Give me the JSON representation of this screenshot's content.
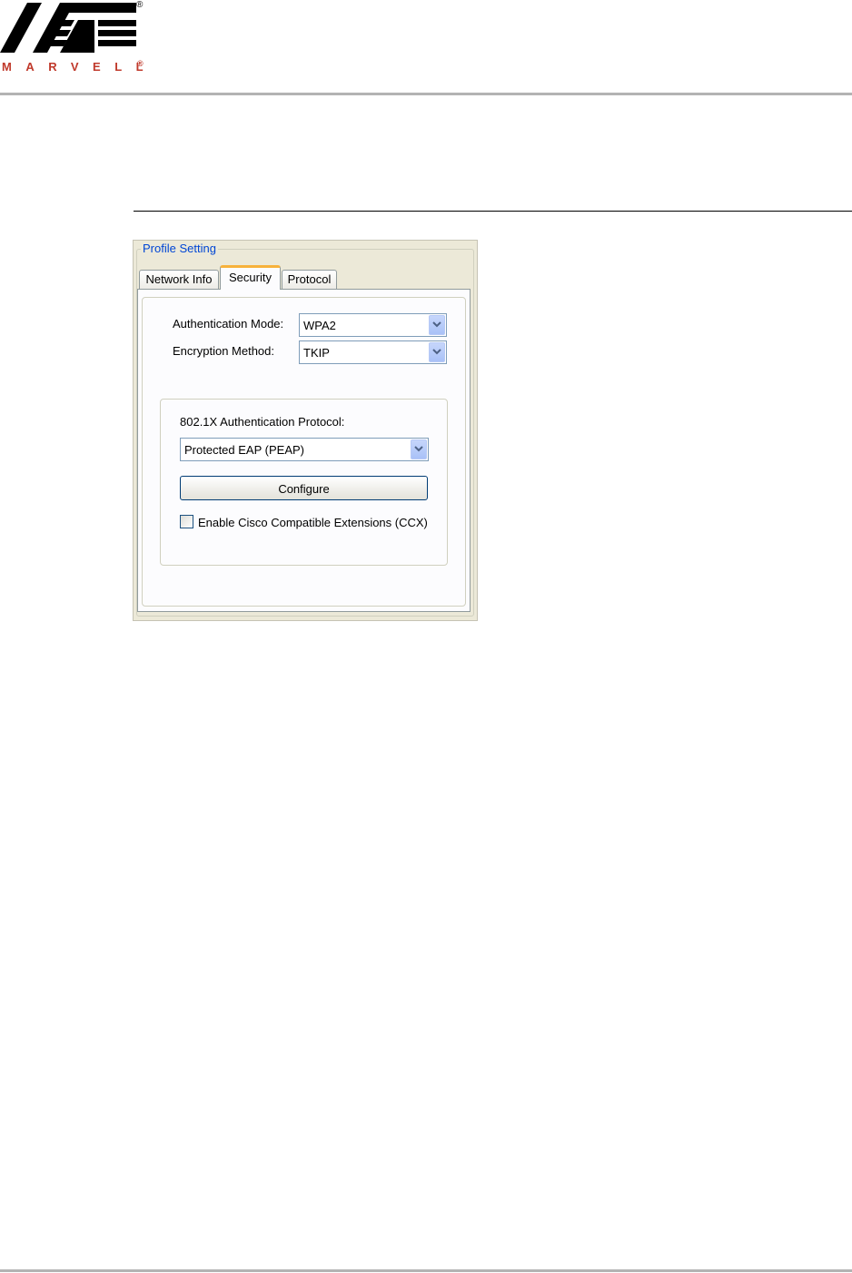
{
  "brand": {
    "wordmark": "MARVELL",
    "registered": "®",
    "logo_icon": "marvell-logo-icon",
    "accent_color": "#c0392b"
  },
  "dialog": {
    "group_title": "Profile Setting",
    "tabs": [
      {
        "label": "Network Info",
        "selected": false
      },
      {
        "label": "Security",
        "selected": true
      },
      {
        "label": "Protocol",
        "selected": false
      }
    ],
    "auth_mode": {
      "label": "Authentication Mode:",
      "value": "WPA2"
    },
    "encryption": {
      "label": "Encryption Method:",
      "value": "TKIP"
    },
    "protocol": {
      "label": "802.1X Authentication Protocol:",
      "value": "Protected EAP (PEAP)"
    },
    "configure_label": "Configure",
    "ccx": {
      "label": "Enable Cisco Compatible Extensions (CCX)",
      "checked": false
    },
    "accent_color": "#0046d5",
    "selected_tab_color": "#f7b23b"
  }
}
